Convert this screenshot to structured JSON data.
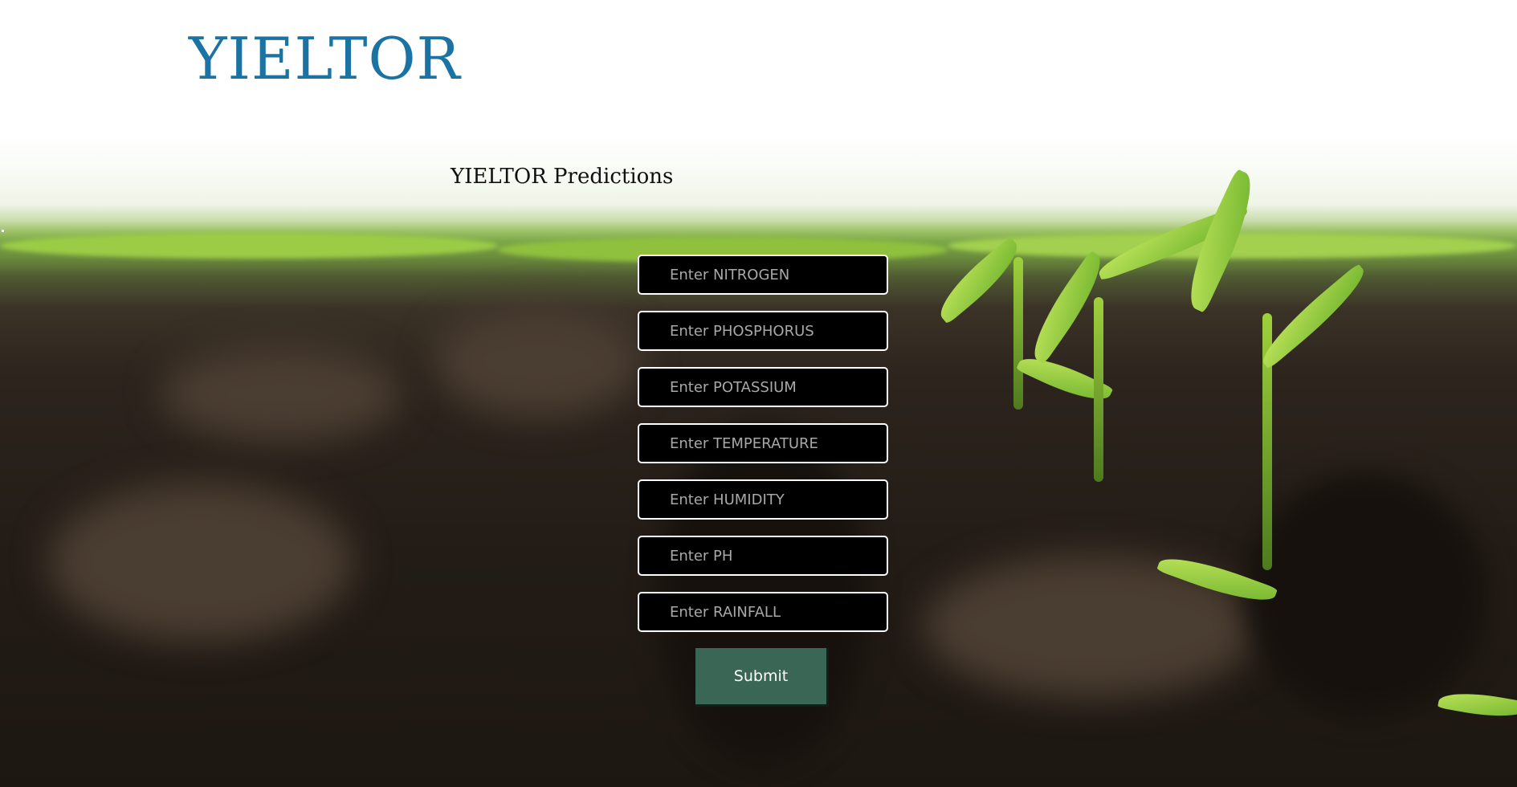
{
  "header": {
    "brand": "YIELTOR"
  },
  "main": {
    "title": "YIELTOR Predictions",
    "fields": [
      {
        "placeholder": "Enter NITROGEN",
        "value": ""
      },
      {
        "placeholder": "Enter PHOSPHORUS",
        "value": ""
      },
      {
        "placeholder": "Enter POTASSIUM",
        "value": ""
      },
      {
        "placeholder": "Enter TEMPERATURE",
        "value": ""
      },
      {
        "placeholder": "Enter HUMIDITY",
        "value": ""
      },
      {
        "placeholder": "Enter PH",
        "value": ""
      },
      {
        "placeholder": "Enter RAINFALL",
        "value": ""
      }
    ],
    "submit_label": "Submit"
  },
  "colors": {
    "brand": "#1a73a3",
    "input_bg": "#000000",
    "input_border": "#ffffff",
    "button_bg": "#3a6655"
  },
  "background_image": "crop-field-seedlings"
}
